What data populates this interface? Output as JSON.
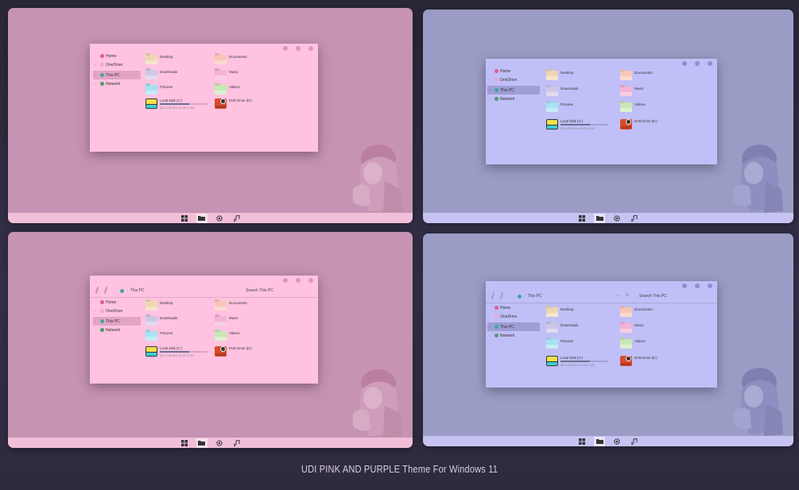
{
  "caption": "UDI PINK AND PURPLE Theme For Windows 11",
  "colors": {
    "pink_bg": "#c693b2",
    "purple_bg": "#9b9cc6",
    "pink_window": "#ffc3e1",
    "purple_window": "#c0bff7"
  },
  "sidebar": {
    "items": [
      {
        "label": "Home",
        "icon": "home-icon"
      },
      {
        "label": "OneDrive",
        "icon": "cloud-icon"
      },
      {
        "label": "This PC",
        "icon": "computer-icon"
      },
      {
        "label": "Network",
        "icon": "network-icon"
      }
    ]
  },
  "folders": [
    {
      "label": "Desktop",
      "color": "#eed7b0"
    },
    {
      "label": "Documents",
      "color": "#f8c6b7"
    },
    {
      "label": "Downloads",
      "color": "#cfc7e7"
    },
    {
      "label": "Music",
      "color": "#f4b2d6"
    },
    {
      "label": "Pictures",
      "color": "#a4e3f1"
    },
    {
      "label": "Videos",
      "color": "#c7e8b4"
    }
  ],
  "drives": {
    "local": {
      "name": "Local Disk (C:)",
      "free": "36.0 GB free of 95.2 GB",
      "used_fraction": 0.62
    },
    "dvd": {
      "name": "DVD Drive (D:)"
    }
  },
  "addressbar": {
    "path": "This PC",
    "search": "Search This PC"
  },
  "taskbar": [
    "windows-start-icon",
    "folder-icon",
    "gear-icon",
    "music-note-icon"
  ]
}
